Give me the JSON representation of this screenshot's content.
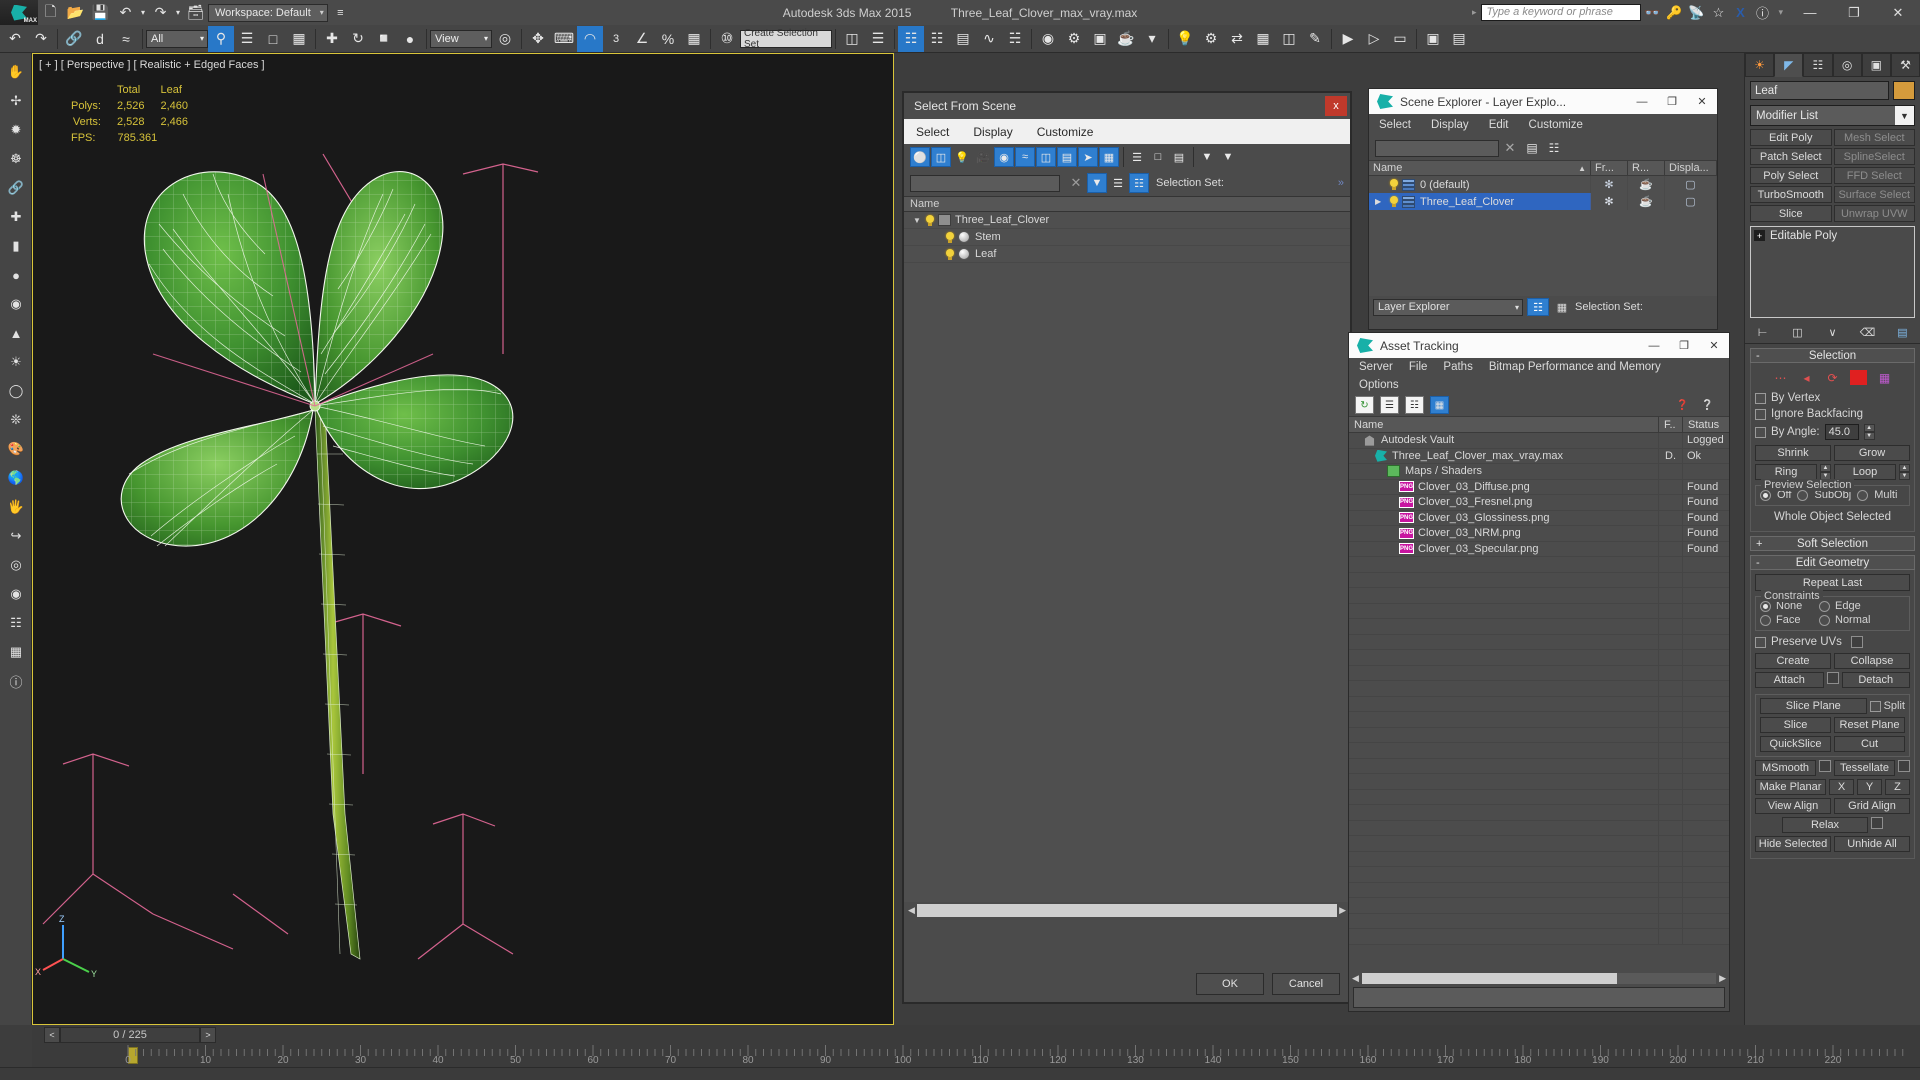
{
  "app": {
    "title_product": "Autodesk 3ds Max  2015",
    "title_file": "Three_Leaf_Clover_max_vray.max",
    "logo_label": "MAX",
    "workspace": "Workspace: Default",
    "quick_search_placeholder": "Type a keyword or phrase",
    "window_buttons": [
      "—",
      "❐",
      "✕"
    ],
    "help_icons": [
      "binoculars-icon",
      "key-icon",
      "satellite-icon",
      "star-icon",
      "exchange-icon",
      "help-icon"
    ]
  },
  "quick_access": {
    "icons": [
      "new-file-icon",
      "open-file-icon",
      "save-file-icon",
      "undo-icon",
      "undo-dropdown-icon",
      "redo-icon",
      "redo-dropdown-icon",
      "project-folder-icon"
    ]
  },
  "main_toolbar": {
    "selection_filter": "All",
    "view_coordinate": "View",
    "named_selection_set": "Create Selection Set",
    "icons": [
      "undo-icon",
      "redo-icon",
      "select-link-icon",
      "unlink-icon",
      "bind-space-warp-icon",
      "select-object-icon",
      "select-by-name-icon",
      "rect-select-region-icon",
      "window-crossing-icon",
      "select-move-icon",
      "select-rotate-icon",
      "select-scale-icon",
      "snap-toggle-icon",
      "angle-snap-icon",
      "percent-snap-icon",
      "spinner-snap-icon",
      "edit-named-selection-icon",
      "mirror-icon",
      "align-icon",
      "layer-explorer-icon",
      "graph-editor-icon",
      "schematic-view-icon",
      "material-editor-icon",
      "render-setup-icon",
      "render-frame-window-icon",
      "render-production-icon",
      "light-icon",
      "gear-icon",
      "curve-editor-icon",
      "sheet-icon",
      "container-icon",
      "script-icon",
      "toggle-scene-explorer-icon",
      "maxscript-icon",
      "render-iterative-icon",
      "render-active-icon",
      "render-region-icon",
      "render-last-icon"
    ]
  },
  "left_toolbar": {
    "icons": [
      "pan-icon",
      "zoom-icon",
      "orbit-icon",
      "select-icon",
      "magnet-icon",
      "sun-icon",
      "cube-icon",
      "sphere-icon",
      "cylinder-icon",
      "cone-icon",
      "light-bulb-icon",
      "torus-icon",
      "spray-icon",
      "paint-icon",
      "globe-icon",
      "hand-icon",
      "hook-icon",
      "target-icon",
      "camera-icon",
      "layers-icon",
      "grid-icon",
      "help-circle-icon"
    ]
  },
  "viewport": {
    "label": "[ + ] [ Perspective ] [ Realistic + Edged Faces ]",
    "stats": {
      "col_headers": [
        "Total",
        "Leaf"
      ],
      "rows": [
        {
          "label": "Polys:",
          "total": "2,526",
          "leaf": "2,460"
        },
        {
          "label": "Verts:",
          "total": "2,528",
          "leaf": "2,466"
        }
      ],
      "fps_label": "FPS:",
      "fps_value": "785.361"
    },
    "axis_labels": [
      "Z",
      "Y",
      "X"
    ],
    "model_name": "Three Leaf Clover"
  },
  "select_from_scene": {
    "title": "Select From Scene",
    "close_label": "x",
    "menu": [
      "Select",
      "Display",
      "Customize"
    ],
    "filter_icons": [
      {
        "name": "display-geometry-icon",
        "on": true
      },
      {
        "name": "display-shapes-icon",
        "on": true
      },
      {
        "name": "display-lights-icon",
        "on": false
      },
      {
        "name": "display-cameras-icon",
        "on": false
      },
      {
        "name": "display-helpers-icon",
        "on": true
      },
      {
        "name": "display-space-warps-icon",
        "on": true
      },
      {
        "name": "display-groups-icon",
        "on": true
      },
      {
        "name": "display-xrefs-icon",
        "on": true
      },
      {
        "name": "display-bones-icon",
        "on": true
      },
      {
        "name": "display-containers-icon",
        "on": true
      },
      {
        "name": "display-frozen-icon",
        "on": false
      },
      {
        "name": "display-hidden-icon",
        "on": false
      },
      {
        "name": "display-all-icon",
        "on": false
      },
      {
        "name": "filter-icon",
        "on": false
      },
      {
        "name": "sort-icon",
        "on": false
      }
    ],
    "find_value": "",
    "column_header": "Name",
    "tree": [
      {
        "name": "Three_Leaf_Clover",
        "indent": 0,
        "expander": "▼",
        "icon": "group-icon"
      },
      {
        "name": "Stem",
        "indent": 1,
        "expander": "",
        "icon": "object-sphere-icon"
      },
      {
        "name": "Leaf",
        "indent": 1,
        "expander": "",
        "icon": "object-sphere-icon"
      }
    ],
    "buttons": {
      "ok": "OK",
      "cancel": "Cancel"
    }
  },
  "scene_explorer": {
    "title": "Scene Explorer - Layer Explo...",
    "window_buttons": [
      "—",
      "❐",
      "✕"
    ],
    "menu": [
      "Select",
      "Display",
      "Edit",
      "Customize"
    ],
    "find_value": "",
    "toolbar_icons": [
      "clear-find-icon",
      "new-layer-icon",
      "layer-manage-icon"
    ],
    "columns": [
      "Name",
      "Fr...",
      "R...",
      "Displa..."
    ],
    "rows": [
      {
        "name": "0 (default)",
        "selected": false,
        "expander": "",
        "frozen": "✻",
        "render": "teapot-icon",
        "display": "box-icon"
      },
      {
        "name": "Three_Leaf_Clover",
        "selected": true,
        "expander": "▶",
        "frozen": "✻",
        "render": "teapot-icon",
        "display": "box-icon"
      }
    ],
    "footer": {
      "explorer_name": "Layer Explorer",
      "selection_set_label": "Selection Set:"
    }
  },
  "asset_tracking": {
    "title": "Asset Tracking",
    "window_buttons": [
      "—",
      "❐",
      "✕"
    ],
    "menu": [
      "Server",
      "File",
      "Paths",
      "Bitmap Performance and Memory",
      "Options"
    ],
    "toolbar_icons": [
      "refresh-icon",
      "list-view-icon",
      "detail-view-icon",
      "grid-view-icon",
      "help-web-icon",
      "help-context-icon"
    ],
    "columns": [
      "Name",
      "F..",
      "Status"
    ],
    "rows": [
      {
        "name": "Autodesk Vault",
        "indent": 0,
        "icon": "vault-icon",
        "flag": "",
        "status": "Logged"
      },
      {
        "name": "Three_Leaf_Clover_max_vray.max",
        "indent": 1,
        "icon": "max-file-icon",
        "flag": "D.",
        "status": "Ok"
      },
      {
        "name": "Maps / Shaders",
        "indent": 2,
        "icon": "maps-shaders-icon",
        "flag": "",
        "status": ""
      },
      {
        "name": "Clover_03_Diffuse.png",
        "indent": 3,
        "icon": "png-icon",
        "flag": "",
        "status": "Found"
      },
      {
        "name": "Clover_03_Fresnel.png",
        "indent": 3,
        "icon": "png-icon",
        "flag": "",
        "status": "Found"
      },
      {
        "name": "Clover_03_Glossiness.png",
        "indent": 3,
        "icon": "png-icon",
        "flag": "",
        "status": "Found"
      },
      {
        "name": "Clover_03_NRM.png",
        "indent": 3,
        "icon": "png-icon",
        "flag": "",
        "status": "Found"
      },
      {
        "name": "Clover_03_Specular.png",
        "indent": 3,
        "icon": "png-icon",
        "flag": "",
        "status": "Found"
      }
    ]
  },
  "command_panel": {
    "tabs": [
      {
        "name": "create-tab",
        "icon": "☀",
        "active": false
      },
      {
        "name": "modify-tab",
        "icon": "◠",
        "active": true
      },
      {
        "name": "hierarchy-tab",
        "icon": "⑂",
        "active": false
      },
      {
        "name": "motion-tab",
        "icon": "◎",
        "active": false
      },
      {
        "name": "display-tab",
        "icon": "▧",
        "active": false
      },
      {
        "name": "utilities-tab",
        "icon": "⚒",
        "active": false
      }
    ],
    "object_name": "Leaf",
    "object_color": "#d59b3c",
    "modifier_list_label": "Modifier List",
    "modifier_buttons": [
      "Edit Poly",
      "Mesh Select",
      "Patch Select",
      "SplineSelect",
      "Poly Select",
      "FFD Select",
      "TurboSmooth",
      "Surface Select",
      "Slice",
      "Unwrap UVW"
    ],
    "stack": [
      {
        "label": "Editable Poly"
      }
    ],
    "stack_buttons": [
      "pin-stack-icon",
      "show-end-result-icon",
      "make-unique-icon",
      "remove-modifier-icon",
      "configure-sets-icon"
    ],
    "rollouts": [
      {
        "title": "Selection",
        "sign": "-",
        "subobject_icons": [
          "vertex-icon",
          "edge-icon",
          "border-icon",
          "polygon-icon",
          "element-icon"
        ],
        "checkboxes": [
          {
            "label": "By Vertex",
            "checked": false
          },
          {
            "label": "Ignore Backfacing",
            "checked": false
          }
        ],
        "by_angle": {
          "label": "By Angle:",
          "value": "45.0",
          "checked": false
        },
        "buttons": [
          "Shrink",
          "Grow",
          "Ring",
          "Loop"
        ],
        "preview_group": {
          "label": "Preview Selection",
          "options": [
            {
              "label": "Off",
              "selected": true
            },
            {
              "label": "SubObj",
              "selected": false
            },
            {
              "label": "Multi",
              "selected": false
            }
          ]
        },
        "status": "Whole Object Selected"
      },
      {
        "title": "Soft Selection",
        "sign": "+"
      },
      {
        "title": "Edit Geometry",
        "sign": "-",
        "repeat_last": "Repeat Last",
        "constraints": {
          "label": "Constraints",
          "options": [
            {
              "label": "None",
              "selected": true
            },
            {
              "label": "Edge",
              "selected": false
            },
            {
              "label": "Face",
              "selected": false
            },
            {
              "label": "Normal",
              "selected": false
            }
          ]
        },
        "preserve_uvs": {
          "label": "Preserve UVs",
          "checked": false
        },
        "buttons": [
          "Create",
          "Collapse",
          "Attach",
          "Detach",
          "Slice Plane",
          "Split",
          "Slice",
          "Reset Plane",
          "QuickSlice",
          "Cut",
          "MSmooth",
          "Tessellate",
          "Make Planar",
          "X",
          "Y",
          "Z",
          "View Align",
          "Grid Align",
          "Relax",
          "Hide Selected",
          "Unhide All"
        ]
      }
    ]
  },
  "timeline": {
    "frame_display": "0 / 225",
    "prev_label": "<",
    "next_label": ">",
    "ticks": [
      "0",
      "10",
      "20",
      "30",
      "40",
      "50",
      "60",
      "70",
      "80",
      "90",
      "100",
      "110",
      "120",
      "130",
      "140",
      "150",
      "160",
      "170",
      "180",
      "190",
      "200",
      "210",
      "220"
    ],
    "current_frame": 0
  }
}
